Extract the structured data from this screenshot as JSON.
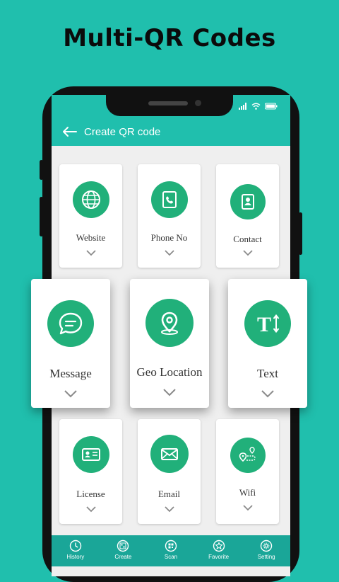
{
  "headline": "Multi-QR Codes",
  "appbar": {
    "title": "Create QR code",
    "back_icon": "arrow-left-icon"
  },
  "status": {
    "icons": [
      "signal-icon",
      "wifi-icon",
      "battery-icon"
    ]
  },
  "colors": {
    "background": "#20bfad",
    "accent": "#21b07a",
    "navbar": "#1aa698"
  },
  "cards": [
    {
      "label": "Website",
      "icon": "globe-icon"
    },
    {
      "label": "Phone No",
      "icon": "phone-icon"
    },
    {
      "label": "Contact",
      "icon": "contact-book-icon"
    },
    {
      "label": "Message",
      "icon": "chat-bubble-icon"
    },
    {
      "label": "Geo Location",
      "icon": "location-pin-icon"
    },
    {
      "label": "Text",
      "icon": "text-size-icon",
      "glyph": "T"
    },
    {
      "label": "License",
      "icon": "id-card-icon"
    },
    {
      "label": "Email",
      "icon": "envelope-icon"
    },
    {
      "label": "Wifi",
      "icon": "route-icon"
    }
  ],
  "nav": [
    {
      "label": "History",
      "icon": "clock-icon"
    },
    {
      "label": "Create",
      "icon": "qr-create-icon"
    },
    {
      "label": "Scan",
      "icon": "qr-scan-icon"
    },
    {
      "label": "Favorite",
      "icon": "star-icon"
    },
    {
      "label": "Setting",
      "icon": "gear-icon"
    }
  ]
}
